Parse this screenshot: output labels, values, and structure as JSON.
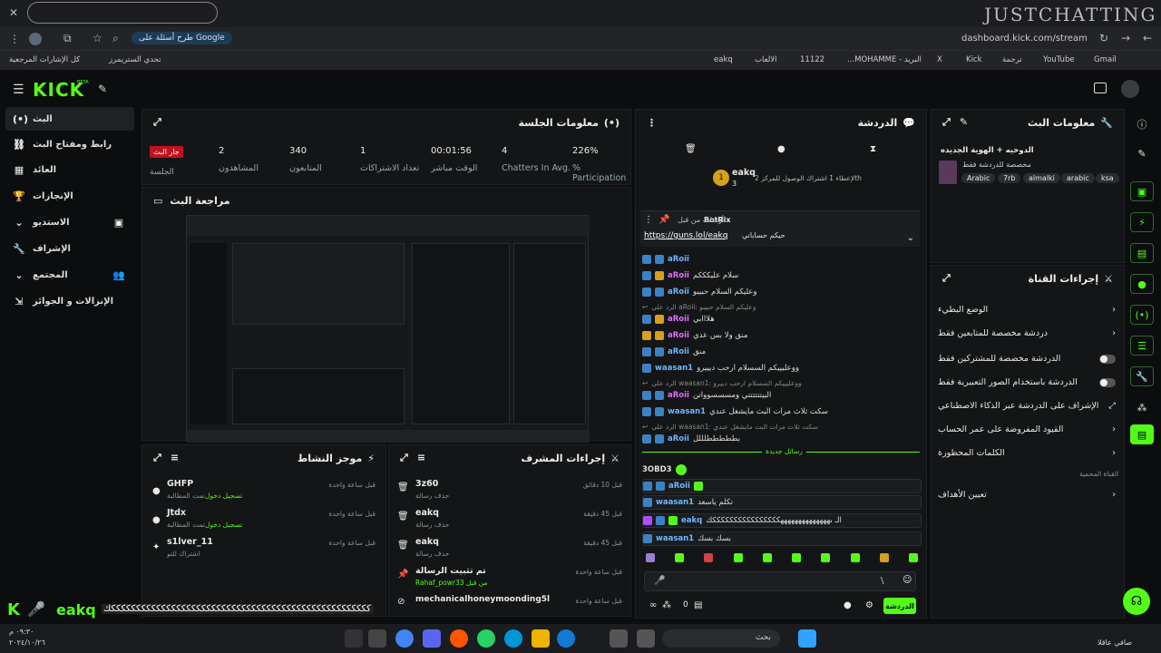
{
  "browser": {
    "watermark": "JUSTCHATTING",
    "url": "dashboard.kick.com/stream",
    "search_chip": "طرح أسئلة على Google",
    "bookmarks": [
      "كل الإشارات المرجعية",
      "تحدي الستريمرز",
      "eakq",
      "الالعاب",
      "11122",
      "...MOHAMME - البريد",
      "X",
      "Kick",
      "ترجمة",
      "YouTube",
      "Gmail"
    ]
  },
  "header": {
    "logo": "KICK",
    "beta": "BETA"
  },
  "sidebar": {
    "items": [
      "البث",
      "رابط ومفتاح البث",
      "العائد",
      "الإنجازات",
      "الاستديو",
      "الإشراف",
      "المجتمع",
      "الإنزالات و الجوائز"
    ]
  },
  "session": {
    "title": "معلومات الجلسة",
    "live": "جار البث",
    "session_label": "الجلسة",
    "stats": [
      {
        "v": "2",
        "l": "المشاهدون"
      },
      {
        "v": "340",
        "l": "المتابعون"
      },
      {
        "v": "1",
        "l": "تعداد الاشتراكات"
      },
      {
        "v": "00:01:56",
        "l": "الوقت مباشر"
      },
      {
        "v": "4",
        "l": "Chatters In Avg."
      },
      {
        "v": "226%",
        "l": "% Participation"
      }
    ]
  },
  "preview": {
    "title": "مراجعة البث"
  },
  "activity": {
    "title": "موجز النشاط",
    "items": [
      {
        "name": "GHFP",
        "desc": "تمت المطالبة",
        "hl": "تسجيل دخول",
        "time": "قبل ساعة واحدة"
      },
      {
        "name": "Jtdx",
        "desc": "تمت المطالبة",
        "hl": "تسجيل دخول",
        "time": "قبل ساعة واحدة"
      },
      {
        "name": "s1lver_11",
        "desc": "اشتراك للتو",
        "hl": "",
        "time": "قبل ساعة واحدة"
      }
    ]
  },
  "mod": {
    "title": "إجراءات المشرف",
    "items": [
      {
        "name": "3z60",
        "desc": "حذف رسالة",
        "time": "قبل 10 دقائق"
      },
      {
        "name": "eakq",
        "desc": "حذف رسالة",
        "time": "قبل 45 دقيقة"
      },
      {
        "name": "eakq",
        "desc": "حذف رسالة",
        "time": "قبل 45 دقيقة"
      },
      {
        "name": "تم تثبيت الرسالة",
        "desc": "Rahaf_powr33 من قبل",
        "time": "قبل ساعة واحدة"
      },
      {
        "name": "mechanicalhoneymoonding5l",
        "desc": "",
        "time": "قبل ساعة واحدة"
      }
    ]
  },
  "chat": {
    "title": "الدردشة",
    "top_user": "eakq",
    "top_count": "3",
    "top_note": "لإعطاء 1 اشتراك الوصول للمركز 2th",
    "pinned_by": "أرسلت من قبل",
    "pinned_user": "BotRix",
    "pinned_link": "https://guns.lol/eakq",
    "pinned_text": "حيكم حساباتي",
    "messages": [
      {
        "u": "aRoii",
        "t": ""
      },
      {
        "u": "",
        "t": "سلام عليكككم"
      },
      {
        "u": "aRoii",
        "t": "وعليكم السلام حبيبو"
      },
      {
        "u": "",
        "t": "الرد على aRoii: وعليكم السلام حبيبو"
      },
      {
        "u": "",
        "t": "هلااابي"
      },
      {
        "u": "",
        "t": "منق ولا بس عدي"
      },
      {
        "u": "aRoii",
        "t": "منق"
      },
      {
        "u": "waasan1",
        "t": "ووعليييكم السسلام ارحب ديييرو"
      },
      {
        "u": "",
        "t": "الرد على waasan1: ووعليييكم السسلام ارحب دييرو"
      },
      {
        "u": "",
        "t": "البيتتتتتتي ومسسسوواتن"
      },
      {
        "u": "waasan1",
        "t": "سكت ثلاث مرات البث مايشغل عندي"
      },
      {
        "u": "",
        "t": "الرد على waasan1: سكت ثلاث مرات البث مايشغل عندي"
      },
      {
        "u": "aRoii",
        "t": "بطططططلللل"
      }
    ],
    "new_label": "رسائل جديدة",
    "new_messages": [
      {
        "u": "3OBD3",
        "t": ""
      },
      {
        "u": "aRoii",
        "t": ""
      },
      {
        "u": "waasan1",
        "t": "تكلم ياسعد"
      },
      {
        "u": "eakq",
        "t": "الـ ىههههههههههههههككككككككككككككككك"
      },
      {
        "u": "waasan1",
        "t": "بسك بسك"
      }
    ],
    "input_placeholder": "\\",
    "send": "الدردشة",
    "count": "0"
  },
  "streaminfo": {
    "title": "معلومات البث",
    "stream_title": "الدوخيه + الهوية الجديده",
    "category": "مخصصة للدردشة فقط",
    "tags": [
      "Arabic",
      "7rb",
      "almalki",
      "arabic",
      "ksa"
    ]
  },
  "channel": {
    "title": "إجراءات القناة",
    "items": [
      "الوضع البطيء",
      "دردشة مخصصة للمتابعين فقط",
      "الدردشة مخصصة للمشتركين فقط",
      "الدردشة باستخدام الصور التعبيرية فقط",
      "الإشراف على الدردشة عبر الذكاء الاصطناعي",
      "القيود المفروضة على عمر الحساب",
      "الكلمات المحظورة"
    ],
    "ai_note": "القناة المحمية",
    "goals": "تعيين الأهداف"
  },
  "ticker": {
    "user": "eakq",
    "text": "ككككككككككككككككككككككككككككككككككككككككككككككككككككك"
  },
  "taskbar": {
    "search": "بحث",
    "time": "٠٩:٣٠ م",
    "date": "٢٠٢٤/١٠/٢٦",
    "user": "صافي عاقلا"
  }
}
